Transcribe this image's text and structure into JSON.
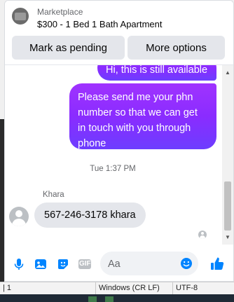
{
  "header": {
    "kind": "Marketplace",
    "listing_title": "$300 - 1 Bed 1 Bath Apartment",
    "mark_pending_label": "Mark as pending",
    "more_options_label": "More options"
  },
  "messages": {
    "previous_outgoing": "Hi, this is still available",
    "outgoing": "Please send me your phn number so that we can get in touch with you through phone",
    "timestamp": "Tue 1:37 PM",
    "sender_name": "Khara",
    "incoming": "567-246-3178 khara"
  },
  "composer": {
    "placeholder": "Aa",
    "icons": [
      "microphone-icon",
      "photo-icon",
      "sticker-icon",
      "gif-icon",
      "emoji-icon",
      "like-icon"
    ],
    "gif_label": "GIF"
  },
  "status_bar": {
    "left": "| 1",
    "line_endings": "Windows (CR LF)",
    "encoding": "UTF-8"
  },
  "colors": {
    "accent": "#0084ff",
    "outgoing_gradient": [
      "#a033ff",
      "#6d3dff"
    ],
    "incoming_bubble": "#e4e6eb"
  }
}
